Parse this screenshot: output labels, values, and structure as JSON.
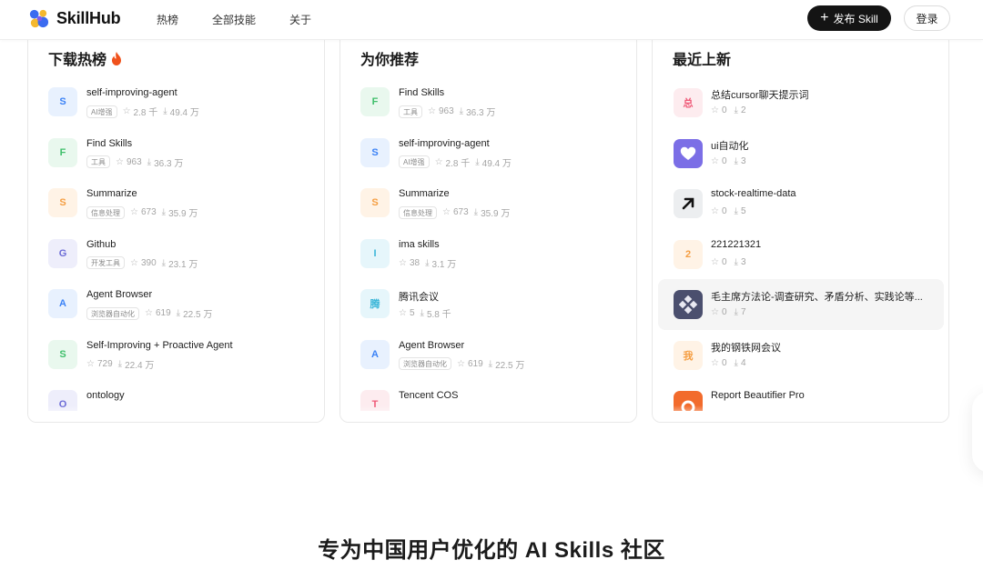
{
  "header": {
    "logo_text": "SkillHub",
    "nav": [
      "热榜",
      "全部技能",
      "关于"
    ],
    "publish_label": "发布 Skill",
    "login_label": "登录"
  },
  "panels": {
    "hot": {
      "title": "下载热榜",
      "items": [
        {
          "letter": "S",
          "name": "self-improving-agent",
          "tag": "AI增强",
          "stars": "2.8 千",
          "downloads": "49.4 万",
          "bg": "#e8f1fe",
          "fg": "#3b82f6"
        },
        {
          "letter": "F",
          "name": "Find Skills",
          "tag": "工具",
          "stars": "963",
          "downloads": "36.3 万",
          "bg": "#e9f8ee",
          "fg": "#3fbf6b"
        },
        {
          "letter": "S",
          "name": "Summarize",
          "tag": "信息处理",
          "stars": "673",
          "downloads": "35.9 万",
          "bg": "#fff3e6",
          "fg": "#f59e42"
        },
        {
          "letter": "G",
          "name": "Github",
          "tag": "开发工具",
          "stars": "390",
          "downloads": "23.1 万",
          "bg": "#eeeefb",
          "fg": "#6b6bd6"
        },
        {
          "letter": "A",
          "name": "Agent Browser",
          "tag": "浏览器自动化",
          "stars": "619",
          "downloads": "22.5 万",
          "bg": "#e8f1fe",
          "fg": "#3b82f6"
        },
        {
          "letter": "S",
          "name": "Self-Improving + Proactive Agent",
          "tag": "",
          "stars": "729",
          "downloads": "22.4 万",
          "bg": "#e9f8ee",
          "fg": "#3fbf6b"
        },
        {
          "letter": "O",
          "name": "ontology",
          "tag": "",
          "stars": "",
          "downloads": "",
          "bg": "#eeeefb",
          "fg": "#6b6bd6"
        }
      ]
    },
    "recommend": {
      "title": "为你推荐",
      "items": [
        {
          "letter": "F",
          "name": "Find Skills",
          "tag": "工具",
          "stars": "963",
          "downloads": "36.3 万",
          "bg": "#e9f8ee",
          "fg": "#3fbf6b"
        },
        {
          "letter": "S",
          "name": "self-improving-agent",
          "tag": "AI增强",
          "stars": "2.8 千",
          "downloads": "49.4 万",
          "bg": "#e8f1fe",
          "fg": "#3b82f6"
        },
        {
          "letter": "S",
          "name": "Summarize",
          "tag": "信息处理",
          "stars": "673",
          "downloads": "35.9 万",
          "bg": "#fff3e6",
          "fg": "#f59e42"
        },
        {
          "letter": "I",
          "name": "ima skills",
          "tag": "",
          "stars": "38",
          "downloads": "3.1 万",
          "bg": "#e6f6fb",
          "fg": "#3bb6d8"
        },
        {
          "letter": "腾",
          "name": "腾讯会议",
          "tag": "",
          "stars": "5",
          "downloads": "5.8 千",
          "bg": "#e6f6fb",
          "fg": "#3bb6d8"
        },
        {
          "letter": "A",
          "name": "Agent Browser",
          "tag": "浏览器自动化",
          "stars": "619",
          "downloads": "22.5 万",
          "bg": "#e8f1fe",
          "fg": "#3b82f6"
        },
        {
          "letter": "T",
          "name": "Tencent COS",
          "tag": "",
          "stars": "",
          "downloads": "",
          "bg": "#fdecef",
          "fg": "#ef5a78"
        }
      ]
    },
    "recent": {
      "title": "最近上新",
      "items": [
        {
          "letter": "总",
          "name": "总结cursor聊天提示词",
          "stars": "0",
          "downloads": "2",
          "bg": "#fdecef",
          "fg": "#ef5a78",
          "icon": "text"
        },
        {
          "letter": "",
          "name": "ui自动化",
          "stars": "0",
          "downloads": "3",
          "bg": "#7b6ee6",
          "fg": "#ffffff",
          "icon": "heart-icon"
        },
        {
          "letter": "",
          "name": "stock-realtime-data",
          "stars": "0",
          "downloads": "5",
          "bg": "#eceef0",
          "fg": "#111111",
          "icon": "arrow-up-right-icon"
        },
        {
          "letter": "2",
          "name": "221221321",
          "stars": "0",
          "downloads": "3",
          "bg": "#fff3e6",
          "fg": "#f59e42",
          "icon": "text"
        },
        {
          "letter": "",
          "name": "毛主席方法论-调查研究、矛盾分析、实践论等...",
          "stars": "0",
          "downloads": "7",
          "bg": "#4b4f6e",
          "fg": "#ffffff",
          "icon": "diamond-grid-icon"
        },
        {
          "letter": "我",
          "name": "我的钢铁网会议",
          "stars": "0",
          "downloads": "4",
          "bg": "#fff3e6",
          "fg": "#f59e42",
          "icon": "text"
        },
        {
          "letter": "",
          "name": "Report Beautifier Pro",
          "stars": "",
          "downloads": "",
          "bg": "#f26b2c",
          "fg": "#ffffff",
          "icon": "report-icon"
        }
      ]
    }
  },
  "headline": "专为中国用户优化的 AI Skills 社区",
  "colors": {
    "accent_dark": "#141414",
    "fire": "#f0521c"
  }
}
